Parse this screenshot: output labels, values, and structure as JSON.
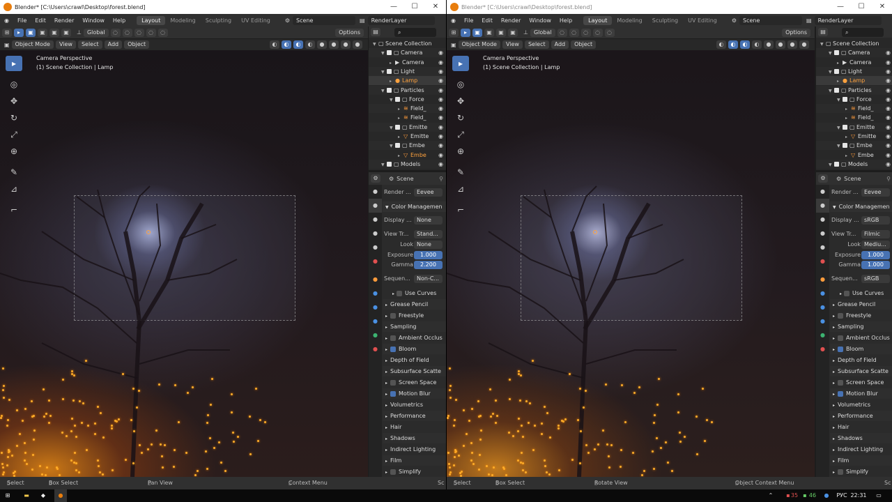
{
  "windows": [
    {
      "id": "left",
      "title": "Blender* [C:\\Users\\crawl\\Desktop\\forest.blend]",
      "menu": [
        "File",
        "Edit",
        "Render",
        "Window",
        "Help"
      ],
      "workspaces": [
        "Layout",
        "Modeling",
        "Sculpting",
        "UV Editing"
      ],
      "active_workspace": "Layout",
      "scene": "Scene",
      "view_layer": "RenderLayer",
      "transform_orientation": "Global",
      "options_label": "Options",
      "mode": "Object Mode",
      "viewport_menus": [
        "View",
        "Select",
        "Add",
        "Object"
      ],
      "viewport_line1": "Camera Perspective",
      "viewport_line2": "(1) Scene Collection | Lamp",
      "outliner": [
        {
          "label": "Scene Collection",
          "depth": 0,
          "type": "collection-root",
          "checked": false
        },
        {
          "label": "Camera",
          "depth": 1,
          "type": "collection",
          "checked": true
        },
        {
          "label": "Camera",
          "depth": 2,
          "type": "camera",
          "checked": false
        },
        {
          "label": "Light",
          "depth": 1,
          "type": "collection",
          "checked": true
        },
        {
          "label": "Lamp",
          "depth": 2,
          "type": "light",
          "checked": false,
          "selected": true
        },
        {
          "label": "Particles",
          "depth": 1,
          "type": "collection",
          "checked": true
        },
        {
          "label": "Force",
          "depth": 2,
          "type": "collection",
          "checked": true
        },
        {
          "label": "Field_",
          "depth": 3,
          "type": "field",
          "checked": false
        },
        {
          "label": "Field_",
          "depth": 3,
          "type": "field",
          "checked": false
        },
        {
          "label": "Emitte",
          "depth": 2,
          "type": "collection",
          "checked": true
        },
        {
          "label": "Emitte",
          "depth": 3,
          "type": "mesh",
          "checked": false
        },
        {
          "label": "Embe",
          "depth": 2,
          "type": "collection",
          "checked": true
        },
        {
          "label": "Embe",
          "depth": 3,
          "type": "mesh",
          "checked": false,
          "orange": true
        },
        {
          "label": "Models",
          "depth": 1,
          "type": "collection",
          "checked": true
        }
      ],
      "properties_header": "Scene",
      "render_engine": {
        "label": "Render ...",
        "value": "Eevee"
      },
      "color_management_title": "Color Managemen",
      "color_management": [
        {
          "label": "Display ...",
          "value": "None",
          "kind": "enum"
        },
        {
          "label": "View Tr...",
          "value": "Stand...",
          "kind": "enum"
        },
        {
          "label": "Look",
          "value": "None",
          "kind": "enum"
        },
        {
          "label": "Exposure",
          "value": "1.000",
          "kind": "num"
        },
        {
          "label": "Gamma",
          "value": "2.200",
          "kind": "num"
        },
        {
          "label": "Sequen...",
          "value": "Non-C...",
          "kind": "enum"
        }
      ],
      "use_curves_label": "Use Curves",
      "panels": [
        {
          "label": "Grease Pencil",
          "check": null
        },
        {
          "label": "Freestyle",
          "check": false
        },
        {
          "label": "Sampling",
          "check": null
        },
        {
          "label": "Ambient Occlus",
          "check": false
        },
        {
          "label": "Bloom",
          "check": true
        },
        {
          "label": "Depth of Field",
          "check": null
        },
        {
          "label": "Subsurface Scatte",
          "check": null
        },
        {
          "label": "Screen Space",
          "check": false
        },
        {
          "label": "Motion Blur",
          "check": true
        },
        {
          "label": "Volumetrics",
          "check": null
        },
        {
          "label": "Performance",
          "check": null
        },
        {
          "label": "Hair",
          "check": null
        },
        {
          "label": "Shadows",
          "check": null
        },
        {
          "label": "Indirect Lighting",
          "check": null
        },
        {
          "label": "Film",
          "check": null
        },
        {
          "label": "Simplify",
          "check": false
        }
      ],
      "status": [
        "Select",
        "Box Select",
        "Pan View",
        "Context Menu",
        "Sc"
      ]
    },
    {
      "id": "right",
      "title": "Blender* [C:\\Users\\crawl\\Desktop\\forest.blend]",
      "menu": [
        "File",
        "Edit",
        "Render",
        "Window",
        "Help"
      ],
      "workspaces": [
        "Layout",
        "Modeling",
        "Sculpting",
        "UV Editing"
      ],
      "active_workspace": "Layout",
      "scene": "Scene",
      "view_layer": "RenderLayer",
      "transform_orientation": "Global",
      "options_label": "Options",
      "mode": "Object Mode",
      "viewport_menus": [
        "View",
        "Select",
        "Add",
        "Object"
      ],
      "viewport_line1": "Camera Perspective",
      "viewport_line2": "(1) Scene Collection | Lamp",
      "outliner": [
        {
          "label": "Scene Collection",
          "depth": 0,
          "type": "collection-root",
          "checked": false
        },
        {
          "label": "Camera",
          "depth": 1,
          "type": "collection",
          "checked": true
        },
        {
          "label": "Camera",
          "depth": 2,
          "type": "camera",
          "checked": false
        },
        {
          "label": "Light",
          "depth": 1,
          "type": "collection",
          "checked": true
        },
        {
          "label": "Lamp",
          "depth": 2,
          "type": "light",
          "checked": false,
          "selected": true
        },
        {
          "label": "Particles",
          "depth": 1,
          "type": "collection",
          "checked": true
        },
        {
          "label": "Force",
          "depth": 2,
          "type": "collection",
          "checked": true
        },
        {
          "label": "Field_",
          "depth": 3,
          "type": "field",
          "checked": false
        },
        {
          "label": "Field_",
          "depth": 3,
          "type": "field",
          "checked": false
        },
        {
          "label": "Emitte",
          "depth": 2,
          "type": "collection",
          "checked": true
        },
        {
          "label": "Emitte",
          "depth": 3,
          "type": "mesh",
          "checked": false
        },
        {
          "label": "Embe",
          "depth": 2,
          "type": "collection",
          "checked": true
        },
        {
          "label": "Embe",
          "depth": 3,
          "type": "mesh",
          "checked": false
        },
        {
          "label": "Models",
          "depth": 1,
          "type": "collection",
          "checked": true
        }
      ],
      "properties_header": "Scene",
      "render_engine": {
        "label": "Render ...",
        "value": "Eevee"
      },
      "color_management_title": "Color Managemen",
      "color_management": [
        {
          "label": "Display ...",
          "value": "sRGB",
          "kind": "enum"
        },
        {
          "label": "View Tr...",
          "value": "Filmic",
          "kind": "enum"
        },
        {
          "label": "Look",
          "value": "Mediu...",
          "kind": "enum"
        },
        {
          "label": "Exposure",
          "value": "1.000",
          "kind": "num"
        },
        {
          "label": "Gamma",
          "value": "1.000",
          "kind": "num"
        },
        {
          "label": "Sequen...",
          "value": "sRGB",
          "kind": "enum"
        }
      ],
      "use_curves_label": "Use Curves",
      "panels": [
        {
          "label": "Grease Pencil",
          "check": null
        },
        {
          "label": "Freestyle",
          "check": false
        },
        {
          "label": "Sampling",
          "check": null
        },
        {
          "label": "Ambient Occlus",
          "check": false
        },
        {
          "label": "Bloom",
          "check": true
        },
        {
          "label": "Depth of Field",
          "check": null
        },
        {
          "label": "Subsurface Scatte",
          "check": null
        },
        {
          "label": "Screen Space",
          "check": false
        },
        {
          "label": "Motion Blur",
          "check": true
        },
        {
          "label": "Volumetrics",
          "check": null
        },
        {
          "label": "Performance",
          "check": null
        },
        {
          "label": "Hair",
          "check": null
        },
        {
          "label": "Shadows",
          "check": null
        },
        {
          "label": "Indirect Lighting",
          "check": null
        },
        {
          "label": "Film",
          "check": null
        },
        {
          "label": "Simplify",
          "check": false
        }
      ],
      "status": [
        "Select",
        "Box Select",
        "Rotate View",
        "Object Context Menu",
        "Sc"
      ]
    }
  ],
  "taskbar": {
    "tray_numbers": [
      "35",
      "46"
    ],
    "language": "РУС",
    "time": "22:31"
  },
  "colors": {
    "accent_blue": "#4772b3",
    "selected_orange": "#ffa23e",
    "ember": "#ffae2a",
    "panel_bg": "#2b2b2b"
  }
}
